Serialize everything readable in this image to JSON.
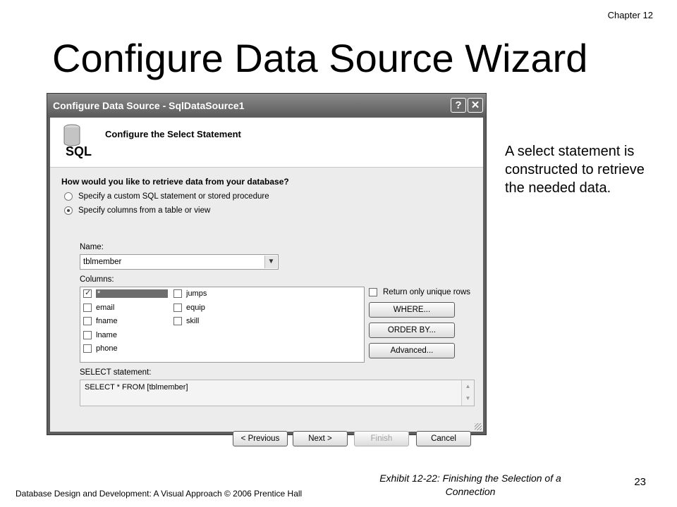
{
  "slide": {
    "chapter": "Chapter 12",
    "title": "Configure Data Source Wizard",
    "side_note": "A select statement is constructed to retrieve the needed data.",
    "footer_left": "Database Design and Development: A Visual Approach   © 2006 Prentice Hall",
    "caption": "Exhibit 12-22: Finishing the Selection of a Connection",
    "page_number": "23"
  },
  "dialog": {
    "title": "Configure Data Source - SqlDataSource1",
    "help_label": "?",
    "close_label": "✕",
    "icon_label": "SQL",
    "step_title": "Configure the Select Statement",
    "question": "How would you like to retrieve data from your database?",
    "options": [
      {
        "label": "Specify a custom SQL statement or stored procedure",
        "selected": false
      },
      {
        "label": "Specify columns from a table or view",
        "selected": true
      }
    ],
    "name_label": "Name:",
    "name_value": "tblmember",
    "columns_label": "Columns:",
    "columns": [
      {
        "label": "*",
        "checked": true
      },
      {
        "label": "email",
        "checked": false
      },
      {
        "label": "fname",
        "checked": false
      },
      {
        "label": "lname",
        "checked": false
      },
      {
        "label": "phone",
        "checked": false
      },
      {
        "label": "jumps",
        "checked": false
      },
      {
        "label": "equip",
        "checked": false
      },
      {
        "label": "skill",
        "checked": false
      }
    ],
    "unique_rows_label": "Return only unique rows",
    "where_button": "WHERE...",
    "order_by_button": "ORDER BY...",
    "advanced_button": "Advanced...",
    "select_statement_label": "SELECT statement:",
    "select_statement": "SELECT * FROM [tblmember]",
    "previous_button": "< Previous",
    "next_button": "Next >",
    "finish_button": "Finish",
    "cancel_button": "Cancel"
  }
}
